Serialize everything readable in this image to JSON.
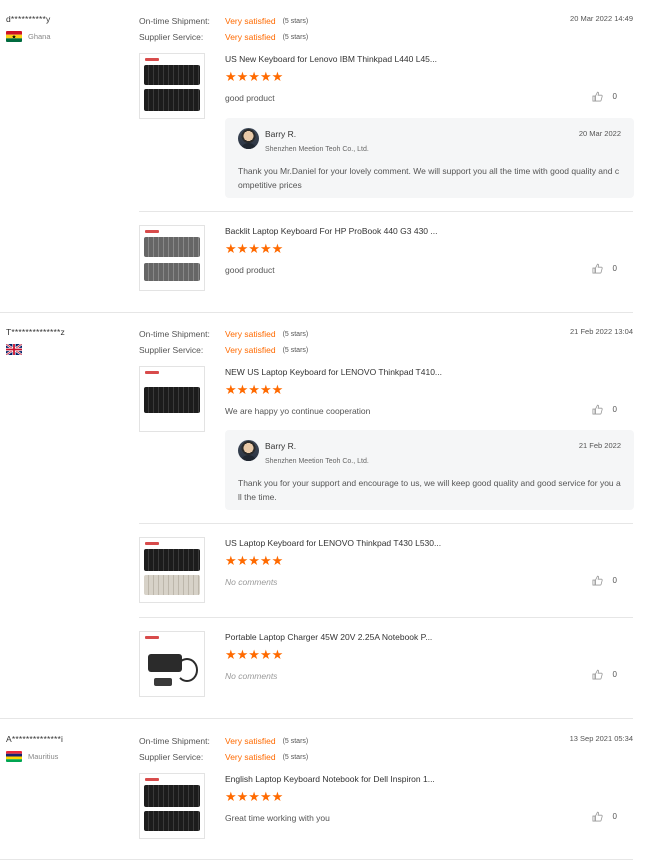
{
  "labels": {
    "ontime": "On-time Shipment:",
    "supplier": "Supplier Service:"
  },
  "colors": {
    "accent": "#ff6a00",
    "divider": "#e6e6e6",
    "reply_bg": "#f5f6f7"
  },
  "reviews": [
    {
      "buyer": "d**********y",
      "country": "Ghana",
      "flag": "ghana-flag",
      "date": "20 Mar 2022 14:49",
      "ontime_value": "Very satisfied",
      "ontime_stars": "(5 stars)",
      "supplier_value": "Very satisfied",
      "supplier_stars": "(5 stars)",
      "products": [
        {
          "title": "US New Keyboard for Lenovo IBM Thinkpad L440 L45...",
          "stars": "★★★★★",
          "rating": 5,
          "comment": "good product",
          "likes": "0",
          "reply": {
            "name": "Barry R.",
            "company": "Shenzhen Meetion Teoh Co., Ltd.",
            "date": "20 Mar 2022",
            "text": "Thank you Mr.Daniel for your lovely comment. We will support you all the time with good quality and competitive prices"
          }
        },
        {
          "title": "Backlit Laptop Keyboard For HP ProBook 440 G3 430 ...",
          "stars": "★★★★★",
          "rating": 5,
          "comment": "good product",
          "likes": "0"
        }
      ]
    },
    {
      "buyer": "T**************z",
      "country": "",
      "flag": "uk-flag",
      "date": "21 Feb 2022 13:04",
      "ontime_value": "Very satisfied",
      "ontime_stars": "(5 stars)",
      "supplier_value": "Very satisfied",
      "supplier_stars": "(5 stars)",
      "products": [
        {
          "title": "NEW US Laptop Keyboard for LENOVO Thinkpad T410...",
          "stars": "★★★★★",
          "rating": 5,
          "comment": "We are happy yo continue cooperation",
          "likes": "0",
          "reply": {
            "name": "Barry R.",
            "company": "Shenzhen Meetion Teoh Co., Ltd.",
            "date": "21 Feb 2022",
            "text": "Thank you for your support and encourage to us, we will keep good quality and good service for you all the time."
          }
        },
        {
          "title": "US Laptop Keyboard for LENOVO Thinkpad T430 L530...",
          "stars": "★★★★★",
          "rating": 5,
          "comment": "No comments",
          "likes": "0"
        },
        {
          "title": "Portable Laptop Charger 45W 20V 2.25A Notebook P...",
          "stars": "★★★★★",
          "rating": 5,
          "comment": "No comments",
          "likes": "0"
        }
      ]
    },
    {
      "buyer": "A**************i",
      "country": "Mauritius",
      "flag": "mauritius-flag",
      "date": "13 Sep 2021 05:34",
      "ontime_value": "Very satisfied",
      "ontime_stars": "(5 stars)",
      "supplier_value": "Very satisfied",
      "supplier_stars": "(5 stars)",
      "products": [
        {
          "title": "English Laptop Keyboard Notebook for Dell Inspiron 1...",
          "stars": "★★★★★",
          "rating": 5,
          "comment": "Great time working with you",
          "likes": "0"
        }
      ]
    }
  ]
}
